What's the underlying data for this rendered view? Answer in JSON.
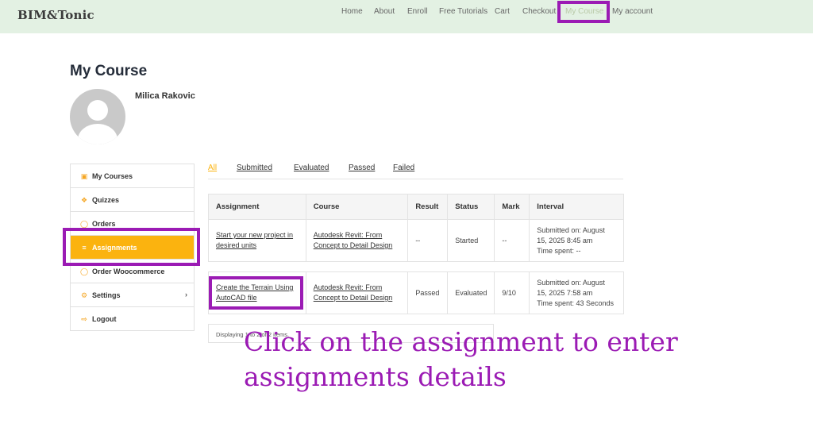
{
  "header": {
    "logo": "BIM&Tonic",
    "nav": [
      {
        "label": "Home"
      },
      {
        "label": "About"
      },
      {
        "label": "Enroll"
      },
      {
        "label": "Free Tutorials"
      },
      {
        "label": "Cart"
      },
      {
        "label": "Checkout"
      },
      {
        "label": "My Course",
        "active": true
      },
      {
        "label": "My account"
      }
    ]
  },
  "page": {
    "title": "My Course",
    "user_name": "Milica Rakovic"
  },
  "sidebar": {
    "items": [
      {
        "label": "My Courses",
        "icon": "courses-icon"
      },
      {
        "label": "Quizzes",
        "icon": "puzzle-icon"
      },
      {
        "label": "Orders",
        "icon": "cart-icon"
      },
      {
        "label": "Assignments",
        "icon": "list-icon",
        "active": true
      },
      {
        "label": "Order Woocommerce",
        "icon": "cart-icon"
      },
      {
        "label": "Settings",
        "icon": "gear-icon",
        "has_submenu": true
      },
      {
        "label": "Logout",
        "icon": "logout-icon"
      }
    ]
  },
  "tabs": [
    {
      "label": "All",
      "active": true
    },
    {
      "label": "Submitted"
    },
    {
      "label": "Evaluated"
    },
    {
      "label": "Passed"
    },
    {
      "label": "Failed"
    }
  ],
  "table": {
    "headers": [
      "Assignment",
      "Course",
      "Result",
      "Status",
      "Mark",
      "Interval"
    ],
    "rows": [
      {
        "assignment": "Start your new project in desired units",
        "course": "Autodesk Revit: From Concept to Detail Design",
        "result": "--",
        "status": "Started",
        "mark": "--",
        "interval": "Submitted on: August 15, 2025 8:45 am",
        "time_spent": "Time spent: --"
      },
      {
        "assignment": "Create the Terrain Using AutoCAD file",
        "course": "Autodesk Revit: From Concept to Detail Design",
        "result": "Passed",
        "status": "Evaluated",
        "mark": "9/10",
        "interval": "Submitted on: August 15, 2025 7:58 am",
        "time_spent": "Time spent: 43 Seconds"
      }
    ],
    "footer": "Displaying 1 to 2 of 2 items."
  },
  "overlay": {
    "instruction_line1": "Click on the assignment to enter",
    "instruction_line2": "assignments details"
  },
  "colors": {
    "header_bg": "#e3f1e3",
    "accent": "#fbb30f",
    "highlight": "#9b1bb4"
  }
}
